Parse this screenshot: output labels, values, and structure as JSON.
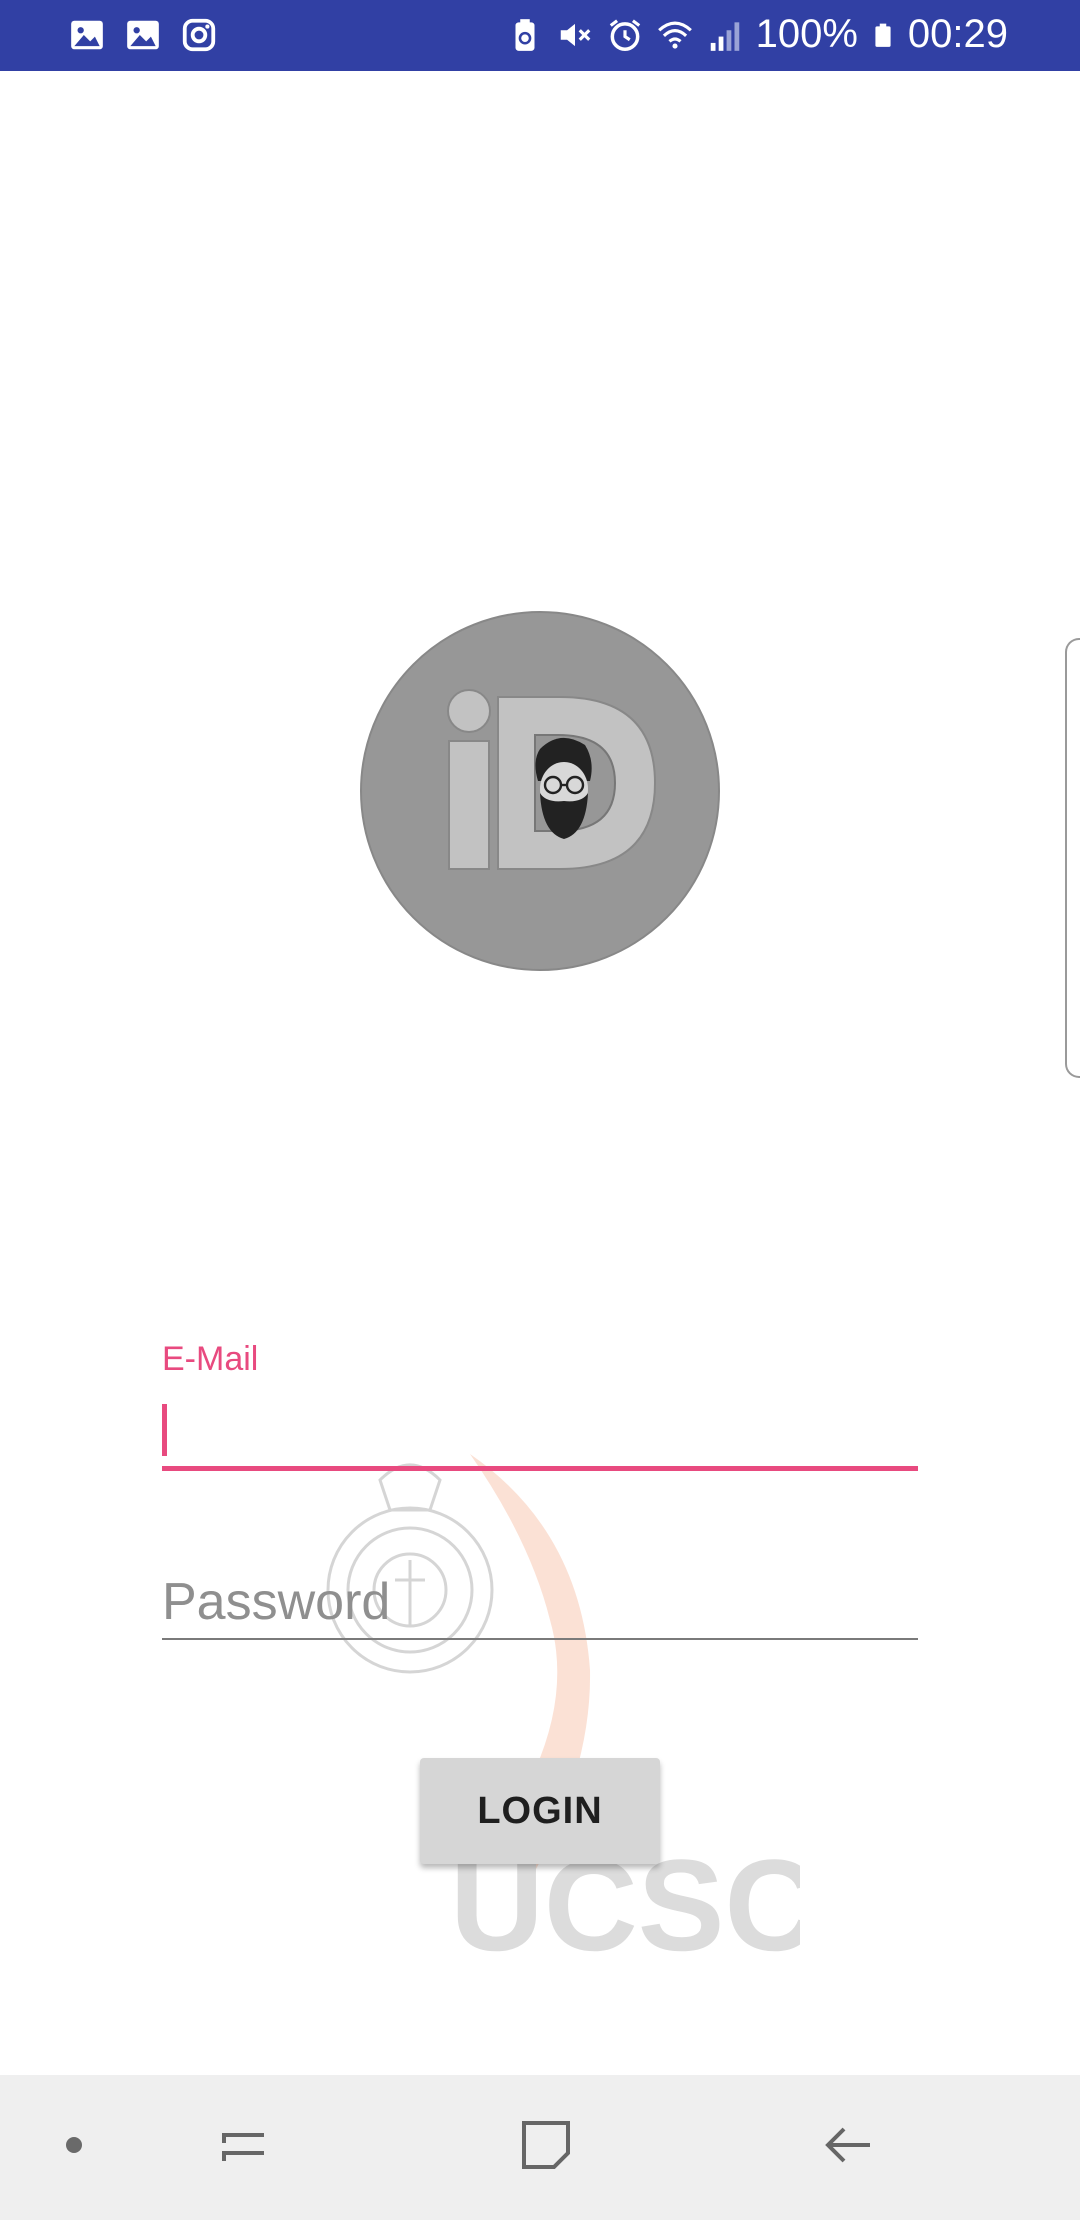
{
  "status_bar": {
    "left_icons": [
      "gallery-icon",
      "gallery-icon",
      "instagram-icon"
    ],
    "right_icons": [
      "battery-saver-icon",
      "mute-icon",
      "alarm-icon",
      "wifi-icon",
      "signal-icon"
    ],
    "battery_percent": "100%",
    "time": "00:29",
    "background_color": "#3140a4"
  },
  "logo": {
    "name": "iD logo with bearded face",
    "text": "iD"
  },
  "watermark": {
    "text": "UCSC"
  },
  "login_form": {
    "email_label": "E-Mail",
    "email_value": "",
    "password_placeholder": "Password",
    "password_value": "",
    "login_button_label": "LOGIN",
    "accent_color": "#e84a7f"
  },
  "nav_bar": {
    "buttons": [
      "dot-indicator",
      "recents-icon",
      "home-icon",
      "back-icon"
    ]
  }
}
